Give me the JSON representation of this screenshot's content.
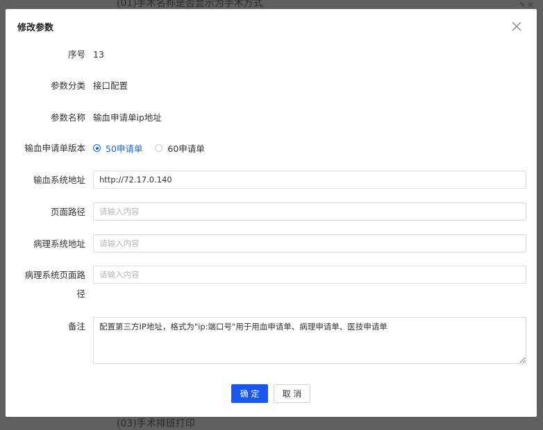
{
  "background": {
    "top_text": "(01)手术名称是否显示为手术方式",
    "bottom_text": "(03)手术排班打印"
  },
  "dialog": {
    "title": "修改参数"
  },
  "form": {
    "seq_label": "序号",
    "seq_value": "13",
    "category_label": "参数分类",
    "category_value": "接口配置",
    "name_label": "参数名称",
    "name_value": "输血申请单ip地址",
    "version_label": "输血申请单版本",
    "version_options": [
      "50申请单",
      "60申请单"
    ],
    "version_selected": "50申请单",
    "blood_addr_label": "输血系统地址",
    "blood_addr_value": "http://72.17.0.140",
    "page_path_label": "页面路径",
    "page_path_placeholder": "请输入内容",
    "patho_addr_label": "病理系统地址",
    "patho_addr_placeholder": "请输入内容",
    "patho_page_label": "病理系统页面路径",
    "patho_page_placeholder": "请输入内容",
    "remark_label": "备注",
    "remark_value": "配置第三方IP地址，格式为\"ip:端口号\"用于用血申请单、病理申请单、医技申请单"
  },
  "buttons": {
    "confirm": "确 定",
    "cancel": "取 消"
  },
  "colors": {
    "primary": "#1a56f0",
    "overlay": "#5f5f5f"
  }
}
